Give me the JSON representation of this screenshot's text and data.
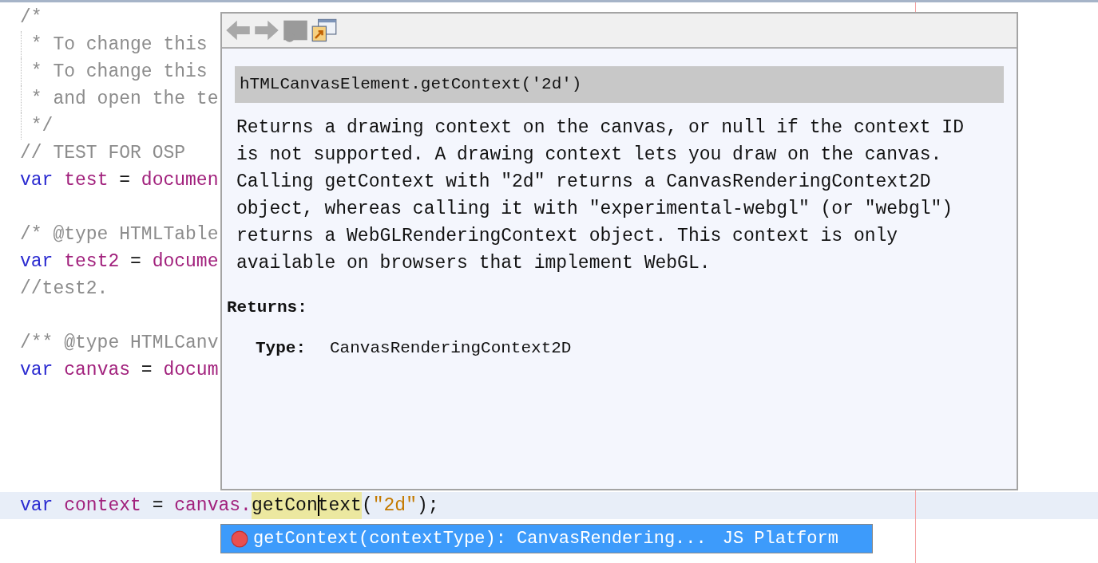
{
  "editor": {
    "lines": [
      {
        "kind": "code",
        "guide": false,
        "current": false,
        "tokens": [
          {
            "text": "/*",
            "kind": "comment"
          }
        ]
      },
      {
        "kind": "code",
        "guide": true,
        "current": false,
        "tokens": [
          {
            "text": " * To change this",
            "kind": "comment"
          }
        ]
      },
      {
        "kind": "code",
        "guide": true,
        "current": false,
        "tokens": [
          {
            "text": " * To change this",
            "kind": "comment"
          }
        ]
      },
      {
        "kind": "code",
        "guide": true,
        "current": false,
        "tokens": [
          {
            "text": " * and open the te",
            "kind": "comment"
          }
        ]
      },
      {
        "kind": "code",
        "guide": true,
        "current": false,
        "tokens": [
          {
            "text": " */",
            "kind": "comment"
          }
        ]
      },
      {
        "kind": "code",
        "guide": false,
        "current": false,
        "tokens": [
          {
            "text": "// TEST FOR OSP",
            "kind": "comment"
          }
        ]
      },
      {
        "kind": "code",
        "guide": false,
        "current": false,
        "tokens": [
          {
            "text": "var",
            "kind": "keyword"
          },
          {
            "text": " test",
            "kind": "identifier"
          },
          {
            "text": " =",
            "kind": "operator"
          },
          {
            "text": " documen",
            "kind": "identifier"
          }
        ]
      },
      {
        "kind": "blank"
      },
      {
        "kind": "code",
        "guide": false,
        "current": false,
        "tokens": [
          {
            "text": "/* @type HTMLTable",
            "kind": "comment"
          }
        ]
      },
      {
        "kind": "code",
        "guide": false,
        "current": false,
        "tokens": [
          {
            "text": "var",
            "kind": "keyword"
          },
          {
            "text": " test2",
            "kind": "identifier"
          },
          {
            "text": " =",
            "kind": "operator"
          },
          {
            "text": " docume",
            "kind": "identifier"
          }
        ]
      },
      {
        "kind": "code",
        "guide": false,
        "current": false,
        "tokens": [
          {
            "text": "//test2.",
            "kind": "comment"
          }
        ]
      },
      {
        "kind": "blank"
      },
      {
        "kind": "code",
        "guide": false,
        "current": false,
        "tokens": [
          {
            "text": "/** @type HTMLCanv",
            "kind": "comment"
          }
        ]
      },
      {
        "kind": "code",
        "guide": false,
        "current": false,
        "tokens": [
          {
            "text": "var",
            "kind": "keyword"
          },
          {
            "text": " canvas",
            "kind": "identifier"
          },
          {
            "text": " =",
            "kind": "operator"
          },
          {
            "text": " docum",
            "kind": "identifier"
          }
        ]
      },
      {
        "kind": "blank"
      },
      {
        "kind": "blank"
      },
      {
        "kind": "blank"
      },
      {
        "kind": "blank"
      },
      {
        "kind": "code",
        "guide": false,
        "current": true,
        "tokens": [
          {
            "text": "var",
            "kind": "keyword"
          },
          {
            "text": " context",
            "kind": "identifier"
          },
          {
            "text": " =",
            "kind": "operator"
          },
          {
            "text": " canvas.",
            "kind": "identifier"
          },
          {
            "text": "getCon",
            "kind": "match"
          },
          {
            "text": "text",
            "kind": "match",
            "caret_before": true
          },
          {
            "text": "(",
            "kind": "operator"
          },
          {
            "text": "\"2d\"",
            "kind": "string"
          },
          {
            "text": ");",
            "kind": "operator"
          }
        ]
      }
    ]
  },
  "doc_popup": {
    "toolbar": [
      {
        "kind": "back",
        "disabled": true
      },
      {
        "kind": "forward",
        "disabled": true
      },
      {
        "kind": "source",
        "disabled": true
      },
      {
        "kind": "external",
        "disabled": false
      }
    ],
    "signature": "hTMLCanvasElement.getContext('2d')",
    "description": "Returns a drawing context on the canvas, or null if the context ID is not supported. A drawing context lets you draw on the canvas. Calling getContext with \"2d\" returns a CanvasRenderingContext2D object, whereas calling it with \"experimental-webgl\" (or \"webgl\") returns a WebGLRenderingContext object. This context is only available on browsers that implement WebGL.",
    "returns_heading": "Returns:",
    "type_label": "Type:",
    "type_value": "CanvasRenderingContext2D"
  },
  "completion": {
    "items": [
      {
        "label": "getContext(contextType): CanvasRendering...",
        "source": "JS Platform",
        "selected": true
      }
    ]
  }
}
